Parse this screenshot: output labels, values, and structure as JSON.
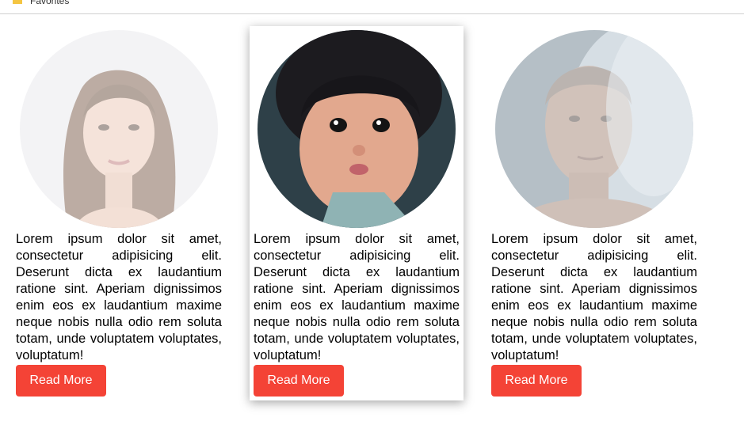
{
  "favorites_bar": {
    "label": "Favorites"
  },
  "cards": [
    {
      "text": "Lorem ipsum dolor sit amet, consectetur adipisicing elit. Deserunt dicta ex laudantium ratione sint. Aperiam dignissimos enim eos ex laudantium maxime neque nobis nulla odio rem soluta totam, unde voluptatem voluptates, voluptatum!",
      "button": "Read More"
    },
    {
      "text": "Lorem ipsum dolor sit amet, consectetur adipisicing elit. Deserunt dicta ex laudantium ratione sint. Aperiam dignissimos enim eos ex laudantium maxime neque nobis nulla odio rem soluta totam, unde voluptatem voluptates, voluptatum!",
      "button": "Read More"
    },
    {
      "text": "Lorem ipsum dolor sit amet, consectetur adipisicing elit. Deserunt dicta ex laudantium ratione sint. Aperiam dignissimos enim eos ex laudantium maxime neque nobis nulla odio rem soluta totam, unde voluptatem voluptates, voluptatum!",
      "button": "Read More"
    }
  ],
  "colors": {
    "button": "#f44336",
    "button_text": "#ffffff"
  }
}
